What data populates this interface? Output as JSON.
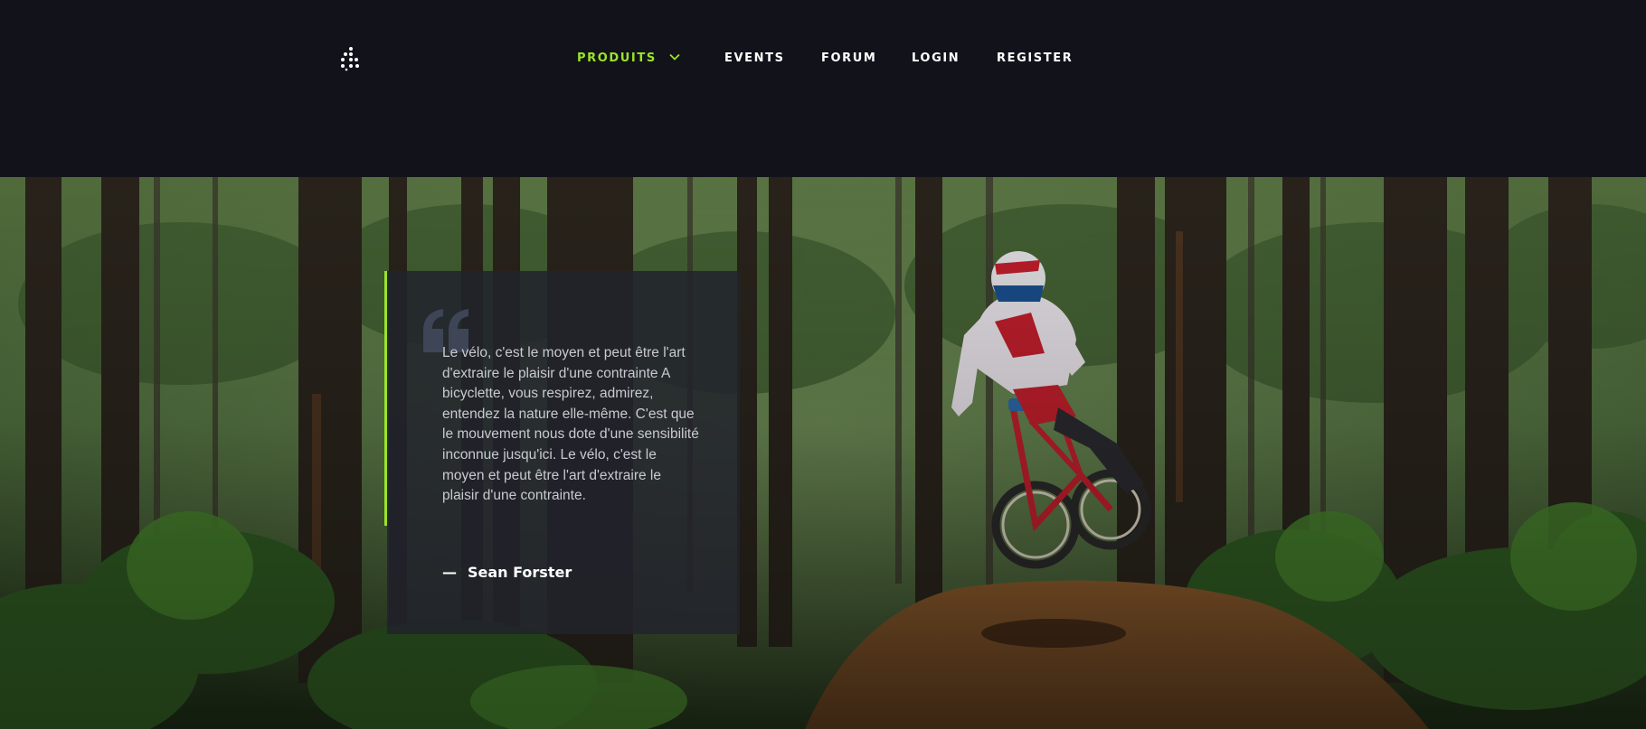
{
  "header": {
    "logo_icon": "dots-logo-icon",
    "nav": [
      {
        "label": "PRODUITS",
        "active": true,
        "has_dropdown": true
      },
      {
        "label": "EVENTS"
      },
      {
        "label": "FORUM"
      },
      {
        "label": "LOGIN"
      },
      {
        "label": "REGISTER"
      }
    ]
  },
  "hero": {
    "background": "forest-mountain-bike-jump-photo",
    "quote": {
      "text": "Le vélo, c'est le moyen et peut être l'art d'extraire le plaisir d'une contrainte A bicyclette, vous respirez, admirez, entendez la nature elle-même. C'est que le mouvement nous dote d'une sensibilité inconnue jusqu'ici. Le vélo, c'est le moyen et peut être l'art d'extraire le plaisir d'une contrainte.",
      "dash": "—",
      "author": "Sean Forster"
    }
  },
  "colors": {
    "accent": "#9be32a",
    "header_bg": "#12131a",
    "card_bg": "#22232c"
  }
}
